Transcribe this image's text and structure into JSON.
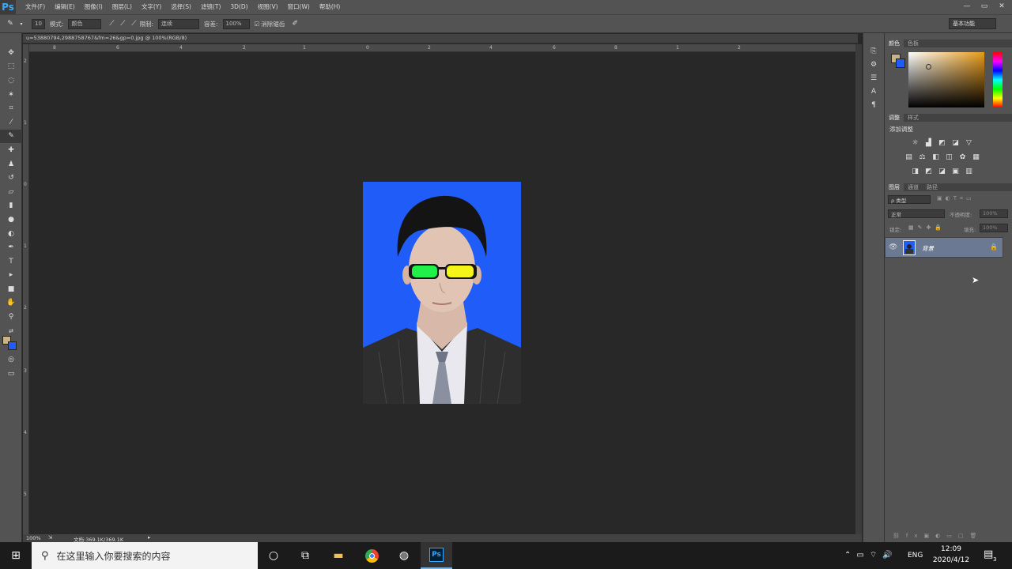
{
  "app": {
    "logo": "Ps"
  },
  "menu": [
    "文件(F)",
    "编辑(E)",
    "图像(I)",
    "图层(L)",
    "文字(Y)",
    "选择(S)",
    "滤镜(T)",
    "3D(D)",
    "视图(V)",
    "窗口(W)",
    "帮助(H)"
  ],
  "window_controls": [
    "—",
    "▭",
    "✕"
  ],
  "options": {
    "brush_size": "10",
    "mode_label": "模式:",
    "mode_value": "颜色",
    "limits_label": "限制:",
    "limits_value": "连续",
    "tolerance_label": "容差:",
    "tolerance_value": "100%",
    "antialias_label": "消除锯齿",
    "workspace": "基本功能"
  },
  "document": {
    "tab_title": "u=53880794,2988758767&fm=26&gp=0.jpg @ 100%(RGB/8)",
    "zoom": "100%",
    "doc_size": "文档:369.1K/369.1K"
  },
  "ruler_h": [
    "8",
    "6",
    "4",
    "2",
    "1",
    "0",
    "2",
    "4",
    "6",
    "8",
    "1",
    "2"
  ],
  "ruler_v": [
    "2",
    "1",
    "0",
    "1",
    "2",
    "3",
    "4",
    "5"
  ],
  "color_panel": {
    "tabs": [
      "颜色",
      "色板"
    ],
    "fg_color": "#c9b48a",
    "bg_color": "#1f5cf8"
  },
  "adjust_panel": {
    "tabs": [
      "调整",
      "样式"
    ],
    "heading": "添加调整"
  },
  "layers_panel": {
    "tabs": [
      "图层",
      "通道",
      "路径"
    ],
    "filter_label": "ρ 类型",
    "blend_mode": "正常",
    "opacity_label": "不透明度:",
    "opacity_value": "100%",
    "lock_label": "锁定:",
    "fill_label": "填充:",
    "fill_value": "100%",
    "layers": [
      {
        "name": "背景",
        "visible": true,
        "locked": true
      }
    ]
  },
  "taskbar": {
    "search_placeholder": "在这里输入你要搜索的内容",
    "lang": "ENG",
    "time": "12:09",
    "date": "2020/4/12",
    "notif_count": "3"
  }
}
